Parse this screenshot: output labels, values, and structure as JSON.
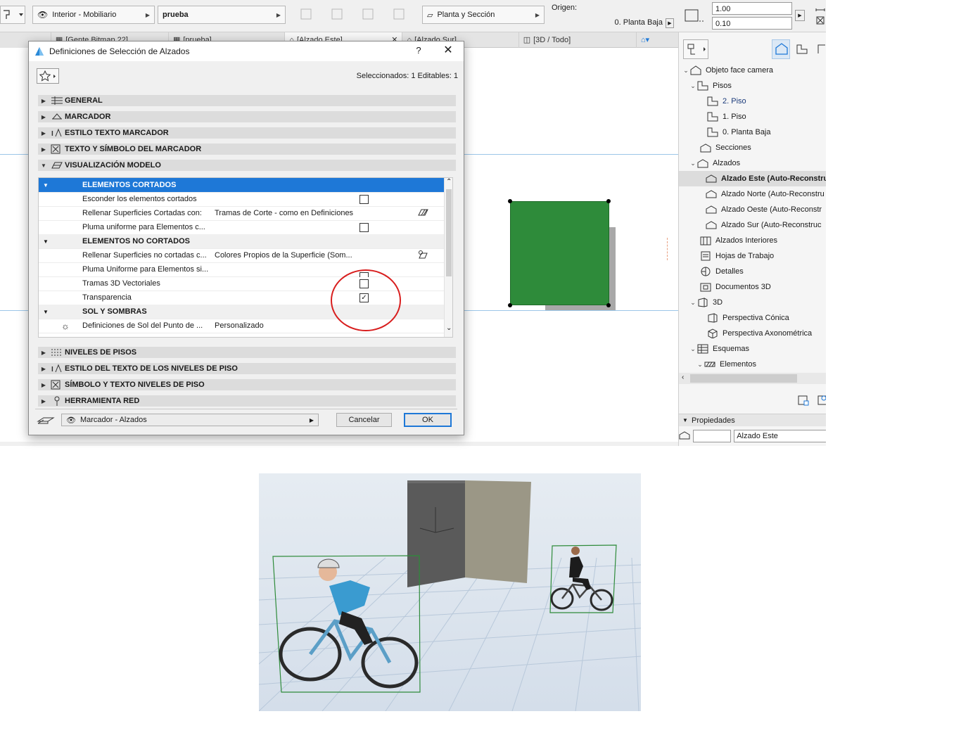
{
  "toolbar": {
    "layer_combo": "Interior - Mobiliario",
    "name_field": "prueba",
    "view_combo": "Planta y Sección",
    "origin_label": "Origen:",
    "origin_value": "0. Planta Baja",
    "scale_top": "1.00",
    "scale_bottom": "0.10"
  },
  "tabs": [
    {
      "label": "[Gente Bitmap 22]"
    },
    {
      "label": "[prueba]"
    },
    {
      "label": "[Alzado Este]"
    },
    {
      "label": "[Alzado Sur]"
    },
    {
      "label": "[3D / Todo]"
    }
  ],
  "navigator": {
    "root": "Objeto face camera",
    "items": [
      {
        "label": "Pisos"
      },
      {
        "label": "2. Piso"
      },
      {
        "label": "1. Piso"
      },
      {
        "label": "0. Planta Baja"
      },
      {
        "label": "Secciones"
      },
      {
        "label": "Alzados"
      },
      {
        "label": "Alzado Este (Auto-Reconstruc"
      },
      {
        "label": "Alzado Norte (Auto-Reconstru"
      },
      {
        "label": "Alzado Oeste (Auto-Reconstr"
      },
      {
        "label": "Alzado Sur (Auto-Reconstruc"
      },
      {
        "label": "Alzados Interiores"
      },
      {
        "label": "Hojas de Trabajo"
      },
      {
        "label": "Detalles"
      },
      {
        "label": "Documentos 3D"
      },
      {
        "label": "3D"
      },
      {
        "label": "Perspectiva Cónica"
      },
      {
        "label": "Perspectiva Axonométrica"
      },
      {
        "label": "Esquemas"
      },
      {
        "label": "Elementos"
      }
    ],
    "properties_header": "Propiedades",
    "properties_name": "Alzado Este"
  },
  "dialog": {
    "title": "Definiciones de Selección de Alzados",
    "help": "?",
    "selection_info": "Seleccionados: 1 Editables: 1",
    "sections_top": [
      {
        "label": "GENERAL"
      },
      {
        "label": "MARCADOR"
      },
      {
        "label": "ESTILO TEXTO MARCADOR"
      },
      {
        "label": "TEXTO Y SÍMBOLO DEL MARCADOR"
      },
      {
        "label": "VISUALIZACIÓN MODELO"
      }
    ],
    "panel": {
      "cut_header": "ELEMENTOS CORTADOS",
      "hide_cut": "Esconder los elementos cortados",
      "fill_cut_label": "Rellenar Superficies Cortadas con:",
      "fill_cut_value": "Tramas de Corte - como en Definiciones",
      "uniform_pen_cut": "Pluma uniforme para Elementos c...",
      "uncut_header": "ELEMENTOS NO CORTADOS",
      "fill_uncut_label": "Rellenar Superficies no cortadas c...",
      "fill_uncut_value": "Colores Propios de la Superficie (Som...",
      "uniform_pen_uncut": "Pluma Uniforme para Elementos si...",
      "vector_hatch": "Tramas 3D Vectoriales",
      "transparency": "Transparencia",
      "sun_header": "SOL Y SOMBRAS",
      "sun_label": "Definiciones de Sol del Punto de ...",
      "sun_value": "Personalizado"
    },
    "sections_bottom": [
      {
        "label": "NIVELES DE PISOS"
      },
      {
        "label": "ESTILO DEL TEXTO DE LOS NIVELES DE PISO"
      },
      {
        "label": "SÍMBOLO Y TEXTO NIVELES DE PISO"
      },
      {
        "label": "HERRAMIENTA RED"
      }
    ],
    "layer_combo": "Marcador - Alzados",
    "cancel": "Cancelar",
    "ok": "OK"
  },
  "colors": {
    "selection_blue": "#1e78d7",
    "element_green": "#2e8b3a",
    "annotation_red": "#d81e1e"
  }
}
